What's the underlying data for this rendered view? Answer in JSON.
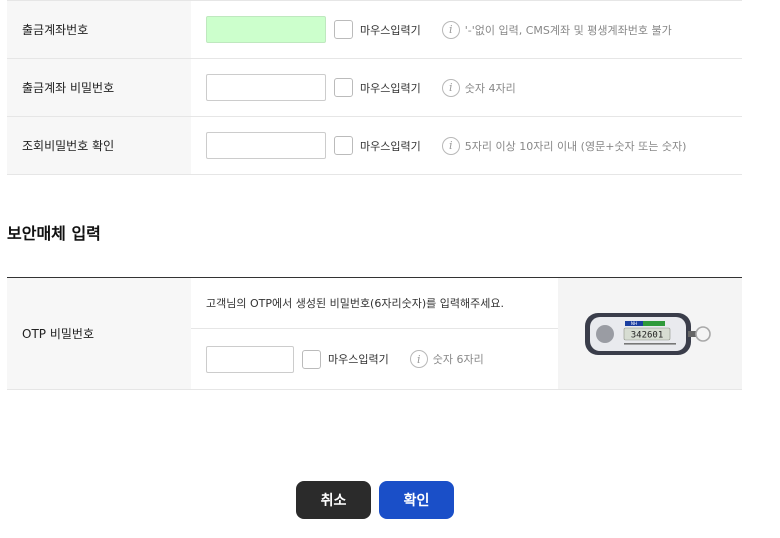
{
  "form": {
    "rows": [
      {
        "label": "출금계좌번호",
        "checkbox_label": "마우스입력기",
        "hint": "'-'없이 입력, CMS계좌 및 평생계좌번호 불가"
      },
      {
        "label": "출금계좌 비밀번호",
        "checkbox_label": "마우스입력기",
        "hint": "숫자 4자리"
      },
      {
        "label": "조회비밀번호 확인",
        "checkbox_label": "마우스입력기",
        "hint": "5자리 이상 10자리 이내 (영문+숫자 또는 숫자)"
      }
    ],
    "info_glyph": "i"
  },
  "security": {
    "title": "보안매체 입력",
    "otp_label": "OTP 비밀번호",
    "description": "고객님의 OTP에서 생성된 비밀번호(6자리숫자)를 입력해주세요.",
    "checkbox_label": "마우스입력기",
    "hint": "숫자 6자리",
    "device_display": "342601",
    "device_brand": "NH"
  },
  "buttons": {
    "cancel": "취소",
    "confirm": "확인"
  },
  "colors": {
    "filled_input": "#ccffcc",
    "confirm": "#1a4fc8",
    "cancel": "#2b2b2b"
  }
}
